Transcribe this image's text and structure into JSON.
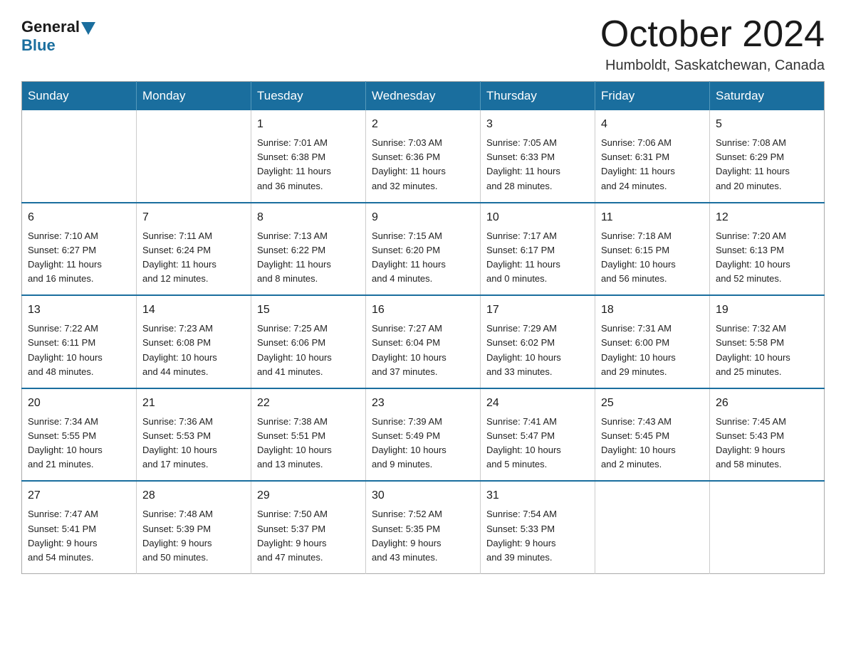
{
  "logo": {
    "general": "General",
    "blue": "Blue"
  },
  "header": {
    "month": "October 2024",
    "location": "Humboldt, Saskatchewan, Canada"
  },
  "weekdays": [
    "Sunday",
    "Monday",
    "Tuesday",
    "Wednesday",
    "Thursday",
    "Friday",
    "Saturday"
  ],
  "weeks": [
    [
      {
        "day": "",
        "info": ""
      },
      {
        "day": "",
        "info": ""
      },
      {
        "day": "1",
        "info": "Sunrise: 7:01 AM\nSunset: 6:38 PM\nDaylight: 11 hours\nand 36 minutes."
      },
      {
        "day": "2",
        "info": "Sunrise: 7:03 AM\nSunset: 6:36 PM\nDaylight: 11 hours\nand 32 minutes."
      },
      {
        "day": "3",
        "info": "Sunrise: 7:05 AM\nSunset: 6:33 PM\nDaylight: 11 hours\nand 28 minutes."
      },
      {
        "day": "4",
        "info": "Sunrise: 7:06 AM\nSunset: 6:31 PM\nDaylight: 11 hours\nand 24 minutes."
      },
      {
        "day": "5",
        "info": "Sunrise: 7:08 AM\nSunset: 6:29 PM\nDaylight: 11 hours\nand 20 minutes."
      }
    ],
    [
      {
        "day": "6",
        "info": "Sunrise: 7:10 AM\nSunset: 6:27 PM\nDaylight: 11 hours\nand 16 minutes."
      },
      {
        "day": "7",
        "info": "Sunrise: 7:11 AM\nSunset: 6:24 PM\nDaylight: 11 hours\nand 12 minutes."
      },
      {
        "day": "8",
        "info": "Sunrise: 7:13 AM\nSunset: 6:22 PM\nDaylight: 11 hours\nand 8 minutes."
      },
      {
        "day": "9",
        "info": "Sunrise: 7:15 AM\nSunset: 6:20 PM\nDaylight: 11 hours\nand 4 minutes."
      },
      {
        "day": "10",
        "info": "Sunrise: 7:17 AM\nSunset: 6:17 PM\nDaylight: 11 hours\nand 0 minutes."
      },
      {
        "day": "11",
        "info": "Sunrise: 7:18 AM\nSunset: 6:15 PM\nDaylight: 10 hours\nand 56 minutes."
      },
      {
        "day": "12",
        "info": "Sunrise: 7:20 AM\nSunset: 6:13 PM\nDaylight: 10 hours\nand 52 minutes."
      }
    ],
    [
      {
        "day": "13",
        "info": "Sunrise: 7:22 AM\nSunset: 6:11 PM\nDaylight: 10 hours\nand 48 minutes."
      },
      {
        "day": "14",
        "info": "Sunrise: 7:23 AM\nSunset: 6:08 PM\nDaylight: 10 hours\nand 44 minutes."
      },
      {
        "day": "15",
        "info": "Sunrise: 7:25 AM\nSunset: 6:06 PM\nDaylight: 10 hours\nand 41 minutes."
      },
      {
        "day": "16",
        "info": "Sunrise: 7:27 AM\nSunset: 6:04 PM\nDaylight: 10 hours\nand 37 minutes."
      },
      {
        "day": "17",
        "info": "Sunrise: 7:29 AM\nSunset: 6:02 PM\nDaylight: 10 hours\nand 33 minutes."
      },
      {
        "day": "18",
        "info": "Sunrise: 7:31 AM\nSunset: 6:00 PM\nDaylight: 10 hours\nand 29 minutes."
      },
      {
        "day": "19",
        "info": "Sunrise: 7:32 AM\nSunset: 5:58 PM\nDaylight: 10 hours\nand 25 minutes."
      }
    ],
    [
      {
        "day": "20",
        "info": "Sunrise: 7:34 AM\nSunset: 5:55 PM\nDaylight: 10 hours\nand 21 minutes."
      },
      {
        "day": "21",
        "info": "Sunrise: 7:36 AM\nSunset: 5:53 PM\nDaylight: 10 hours\nand 17 minutes."
      },
      {
        "day": "22",
        "info": "Sunrise: 7:38 AM\nSunset: 5:51 PM\nDaylight: 10 hours\nand 13 minutes."
      },
      {
        "day": "23",
        "info": "Sunrise: 7:39 AM\nSunset: 5:49 PM\nDaylight: 10 hours\nand 9 minutes."
      },
      {
        "day": "24",
        "info": "Sunrise: 7:41 AM\nSunset: 5:47 PM\nDaylight: 10 hours\nand 5 minutes."
      },
      {
        "day": "25",
        "info": "Sunrise: 7:43 AM\nSunset: 5:45 PM\nDaylight: 10 hours\nand 2 minutes."
      },
      {
        "day": "26",
        "info": "Sunrise: 7:45 AM\nSunset: 5:43 PM\nDaylight: 9 hours\nand 58 minutes."
      }
    ],
    [
      {
        "day": "27",
        "info": "Sunrise: 7:47 AM\nSunset: 5:41 PM\nDaylight: 9 hours\nand 54 minutes."
      },
      {
        "day": "28",
        "info": "Sunrise: 7:48 AM\nSunset: 5:39 PM\nDaylight: 9 hours\nand 50 minutes."
      },
      {
        "day": "29",
        "info": "Sunrise: 7:50 AM\nSunset: 5:37 PM\nDaylight: 9 hours\nand 47 minutes."
      },
      {
        "day": "30",
        "info": "Sunrise: 7:52 AM\nSunset: 5:35 PM\nDaylight: 9 hours\nand 43 minutes."
      },
      {
        "day": "31",
        "info": "Sunrise: 7:54 AM\nSunset: 5:33 PM\nDaylight: 9 hours\nand 39 minutes."
      },
      {
        "day": "",
        "info": ""
      },
      {
        "day": "",
        "info": ""
      }
    ]
  ]
}
